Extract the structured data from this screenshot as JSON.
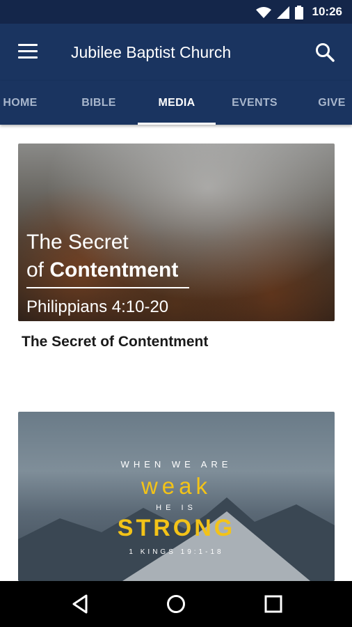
{
  "status_bar": {
    "time": "10:26"
  },
  "app_bar": {
    "title": "Jubilee Baptist Church"
  },
  "tabs": [
    {
      "label": "HOME"
    },
    {
      "label": "BIBLE"
    },
    {
      "label": "MEDIA"
    },
    {
      "label": "EVENTS"
    },
    {
      "label": "GIVE"
    }
  ],
  "active_tab": "MEDIA",
  "media": [
    {
      "image_title_line1": "The Secret",
      "image_title_line2_prefix": "of ",
      "image_title_line2_bold": "Contentment",
      "image_reference": "Philippians 4:10-20",
      "title": "The Secret of Contentment"
    },
    {
      "line1": "WHEN WE ARE",
      "word1": "weak",
      "line2": "HE IS",
      "word2": "STRONG",
      "reference": "1 KINGS 19:1-18"
    }
  ],
  "colors": {
    "primary": "#1a3460",
    "status": "#14264a",
    "accent_yellow": "#f3c318"
  },
  "icons": [
    "wifi-icon",
    "signal-icon",
    "battery-icon",
    "menu-icon",
    "search-icon",
    "back-icon",
    "home-icon",
    "recents-icon"
  ]
}
